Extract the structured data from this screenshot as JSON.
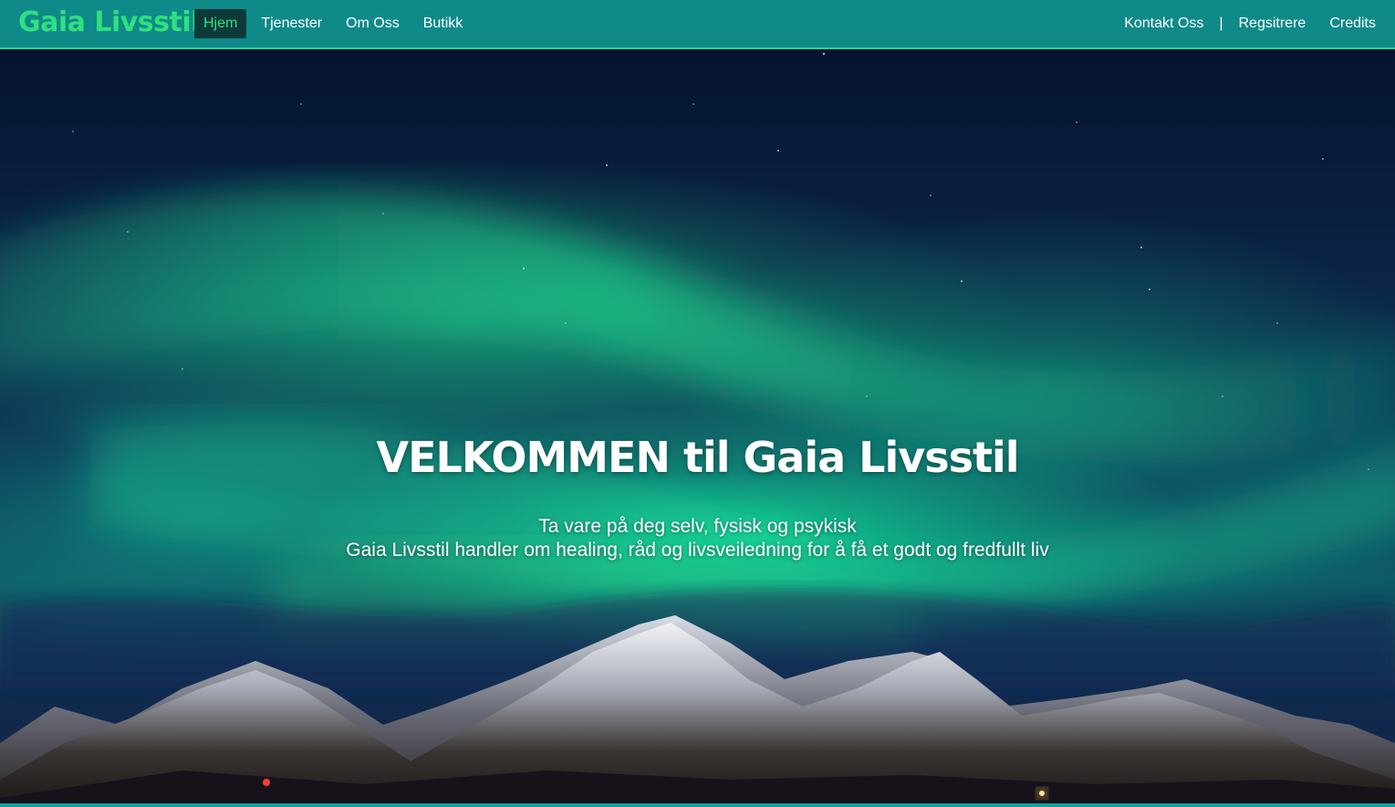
{
  "header": {
    "brand": "Gaia Livsstil",
    "nav_left": [
      {
        "label": "Hjem",
        "active": true
      },
      {
        "label": "Tjenester",
        "active": false
      },
      {
        "label": "Om Oss",
        "active": false
      },
      {
        "label": "Butikk",
        "active": false
      }
    ],
    "nav_right": [
      {
        "label": "Kontakt Oss"
      },
      {
        "label": "Regsitrere"
      },
      {
        "label": "Credits"
      }
    ],
    "separator": "|"
  },
  "hero": {
    "title_prefix": "VELKOMMEN til",
    "title_brand": "Gaia Livsstil",
    "subtitle_line1": "Ta vare på deg selv, fysisk og psykisk",
    "subtitle_line2": "Gaia Livsstil handler om healing, råd og livsveiledning for å få et godt og fredfullt liv"
  },
  "colors": {
    "navbar_bg": "#0f8a89",
    "navbar_border": "#2bd495",
    "brand": "#2fe07e",
    "active_bg": "#0c3a3a",
    "text": "#ffffff"
  }
}
